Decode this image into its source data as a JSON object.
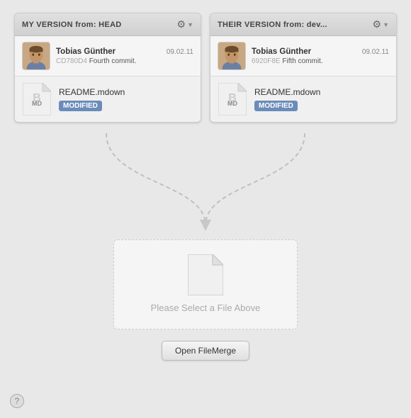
{
  "left_panel": {
    "title": "MY VERSION from: HEAD",
    "gear_label": "⚙",
    "author": "Tobias Günther",
    "date": "09.02.11",
    "hash": "CD780D4",
    "message": "Fourth commit.",
    "file_name": "README.mdown",
    "badge": "MODIFIED"
  },
  "right_panel": {
    "title": "THEIR VERSION from: dev...",
    "gear_label": "⚙",
    "author": "Tobias Günther",
    "date": "09.02.11",
    "hash": "6920F8E",
    "message": "Fifth commit.",
    "file_name": "README.mdown",
    "badge": "MODIFIED"
  },
  "output": {
    "placeholder": "Please Select a File Above"
  },
  "buttons": {
    "open_filemerge": "Open FileMerge",
    "help": "?"
  }
}
